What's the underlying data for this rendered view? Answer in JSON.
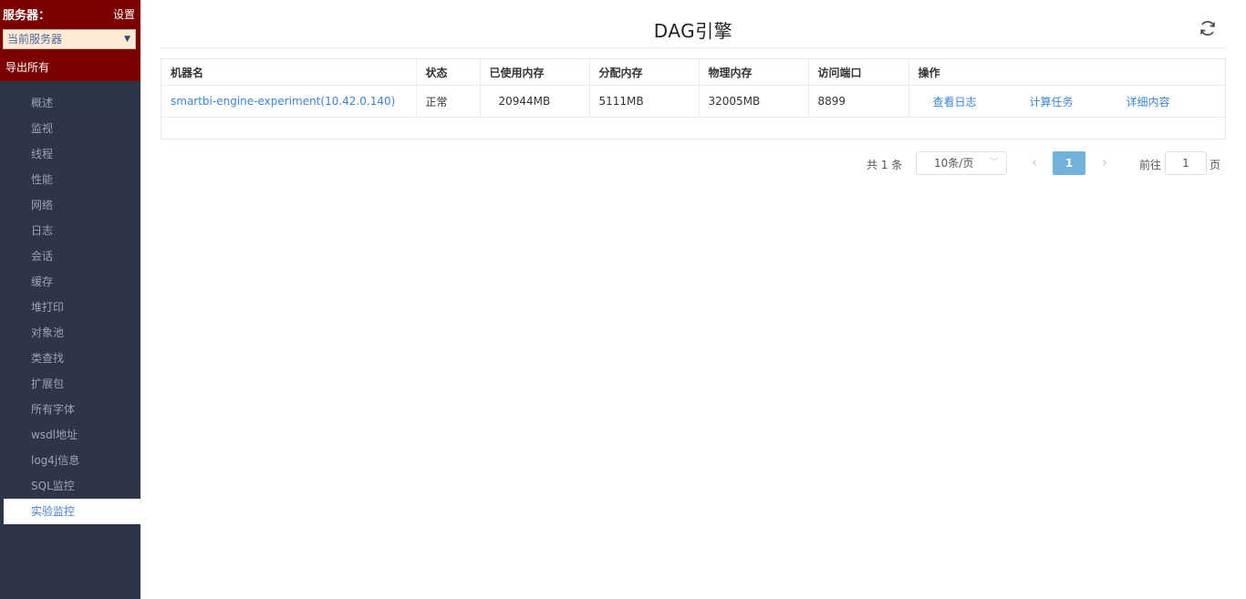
{
  "sidebar": {
    "server_label": "服务器：",
    "settings_label": "设置",
    "server_select": "当前服务器",
    "export_label": "导出所有",
    "items": [
      {
        "label": "概述"
      },
      {
        "label": "监视"
      },
      {
        "label": "线程"
      },
      {
        "label": "性能"
      },
      {
        "label": "网络"
      },
      {
        "label": "日志"
      },
      {
        "label": "会话"
      },
      {
        "label": "缓存"
      },
      {
        "label": "堆打印"
      },
      {
        "label": "对象池"
      },
      {
        "label": "类查找"
      },
      {
        "label": "扩展包"
      },
      {
        "label": "所有字体"
      },
      {
        "label": "wsdl地址"
      },
      {
        "label": "log4j信息"
      },
      {
        "label": "SQL监控"
      },
      {
        "label": "实验监控"
      }
    ],
    "active_item": "实验监控"
  },
  "header": {
    "title": "DAG引擎"
  },
  "table": {
    "columns": [
      "机器名",
      "状态",
      "已使用内存",
      "分配内存",
      "物理内存",
      "访问端口",
      "操作"
    ],
    "rows": [
      {
        "machine": "smartbi-engine-experiment(10.42.0.140)",
        "status": "正常",
        "used_memory": "20944MB",
        "allocated_memory": "5111MB",
        "physical_memory": "32005MB",
        "port": "8899",
        "actions": [
          "查看日志",
          "计算任务",
          "详细内容"
        ]
      }
    ]
  },
  "pagination": {
    "total_text": "共 1 条",
    "page_size": "10条/页",
    "current_page": "1",
    "goto_label": "前往",
    "goto_value": "1",
    "page_unit": "页"
  },
  "colors": {
    "sidebar_bg": "#2c3648",
    "sidebar_header_bg": "#7d0000",
    "link": "#3a86d4",
    "active_page": "#6fb3da"
  }
}
